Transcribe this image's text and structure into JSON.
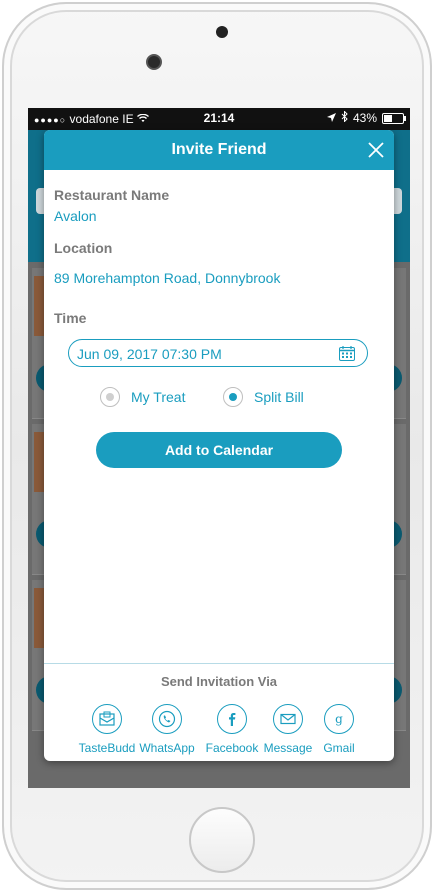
{
  "status_bar": {
    "carrier": "vodafone IE",
    "time": "21:14",
    "battery": "43%"
  },
  "modal": {
    "title": "Invite Friend",
    "restaurant_label": "Restaurant Name",
    "restaurant_value": "Avalon",
    "location_label": "Location",
    "location_value": "89 Morehampton Road, Donnybrook",
    "time_label": "Time",
    "datetime_value": "Jun 09, 2017 07:30 PM",
    "options": [
      {
        "label": "My Treat",
        "selected": false
      },
      {
        "label": "Split Bill",
        "selected": true
      }
    ],
    "add_to_calendar": "Add to Calendar",
    "send_via_label": "Send Invitation Via",
    "share": [
      {
        "label": "TasteBudd",
        "icon": "tastebudd-icon"
      },
      {
        "label": "WhatsApp",
        "icon": "whatsapp-icon"
      },
      {
        "label": "Facebook",
        "icon": "facebook-icon"
      },
      {
        "label": "Message",
        "icon": "message-icon"
      },
      {
        "label": "Gmail",
        "icon": "gmail-icon"
      }
    ]
  },
  "colors": {
    "accent": "#1a9dbf",
    "label_gray": "#7a7a7a"
  }
}
